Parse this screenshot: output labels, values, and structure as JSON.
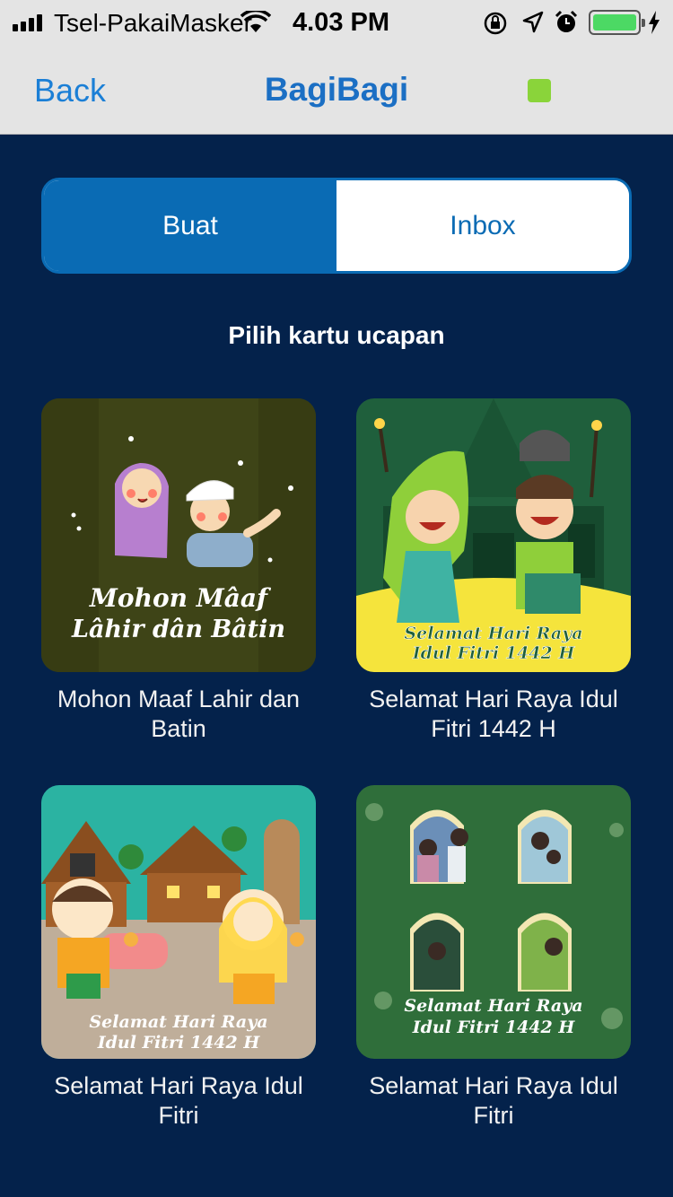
{
  "status_bar": {
    "carrier": "Tsel-PakaiMasker",
    "time": "4.03 PM",
    "icons": [
      "signal-icon",
      "wifi-icon",
      "rotation-lock-icon",
      "location-icon",
      "alarm-icon",
      "battery-icon",
      "charging-icon"
    ],
    "battery_level": 1.0
  },
  "nav": {
    "back_label": "Back",
    "title": "BagiBagi"
  },
  "tabs": [
    {
      "label": "Buat",
      "active": true
    },
    {
      "label": "Inbox",
      "active": false
    }
  ],
  "section_title": "Pilih kartu ucapan",
  "cards": [
    {
      "label": "Mohon Maaf Lahir dan Batin",
      "art_text": [
        "Mohon Mâaf",
        "Lâhir dân Bâtin"
      ]
    },
    {
      "label": "Selamat Hari Raya Idul Fitri 1442 H",
      "art_text": [
        "Selamat Hari Raya",
        "Idul Fitri 1442 H"
      ]
    },
    {
      "label": "Selamat Hari Raya Idul Fitri",
      "art_text": [
        "Selamat Hari Raya",
        "Idul Fitri 1442 H"
      ]
    },
    {
      "label": "Selamat Hari Raya Idul Fitri",
      "art_text": [
        "Selamat Hari Raya",
        "Idul Fitri 1442 H"
      ]
    }
  ],
  "colors": {
    "background": "#04224b",
    "bar": "#e4e4e4",
    "accent": "#0a6bb4",
    "nav_text": "#1b7fd6",
    "indicator": "#8ad43a"
  }
}
